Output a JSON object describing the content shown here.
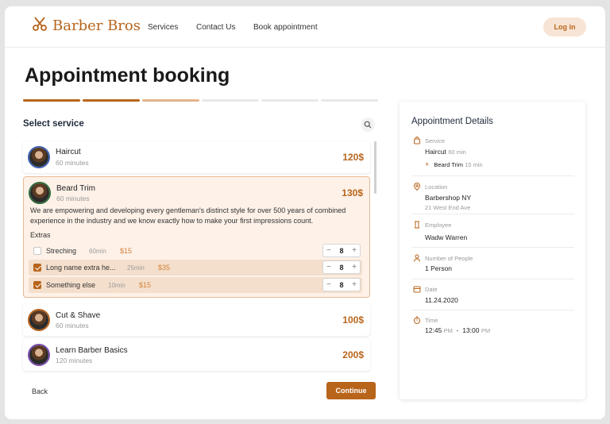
{
  "brand": {
    "name": "Barber Bros",
    "accent": "#b8641b"
  },
  "nav": {
    "items": [
      "Services",
      "Contact Us",
      "Book appointment"
    ],
    "login": "Log in"
  },
  "page": {
    "title": "Appointment booking",
    "progress_steps": 6,
    "steps_done": 2,
    "step_partial": 1
  },
  "select": {
    "title": "Select service",
    "search_icon": "search-icon"
  },
  "services": [
    {
      "name": "Haircut",
      "duration": "60 minutes",
      "price": "120$"
    },
    {
      "name": "Beard Trim",
      "duration": "60 minutes",
      "price": "130$",
      "description": "We are empowering and developing every gentleman's distinct style for over 500 years of combined experience in the industry and we know exactly how to make your first impressions count.",
      "extras_label": "Extras",
      "extras": [
        {
          "name": "Streching",
          "minutes": "60min",
          "price": "$15",
          "checked": false,
          "qty": "8"
        },
        {
          "name": "Long name extra he...",
          "minutes": "25min",
          "price": "$35",
          "checked": true,
          "qty": "8"
        },
        {
          "name": "Something else",
          "minutes": "10min",
          "price": "$15",
          "checked": true,
          "qty": "8"
        }
      ]
    },
    {
      "name": "Cut & Shave",
      "duration": "60 minutes",
      "price": "100$"
    },
    {
      "name": "Learn Barber Basics",
      "duration": "120 minutes",
      "price": "200$"
    }
  ],
  "actions": {
    "back": "Back",
    "continue": "Continue"
  },
  "details": {
    "title": "Appointment Details",
    "service": {
      "label": "Service",
      "value": "Haircut",
      "value_sub": "60 min",
      "extra": "Beard Trim",
      "extra_sub": "15 min"
    },
    "location": {
      "label": "Location",
      "value": "Barbershop NY",
      "sub": "21 West End Ave"
    },
    "employee": {
      "label": "Employee",
      "value": "Wadw Warren"
    },
    "people": {
      "label": "Number of People",
      "value": "1 Person"
    },
    "date": {
      "label": "Date",
      "value": "11.24.2020"
    },
    "time": {
      "label": "Time",
      "start": "12:45",
      "start_ampm": "PM",
      "sep": "-",
      "end": "13:00",
      "end_ampm": "PM"
    }
  }
}
